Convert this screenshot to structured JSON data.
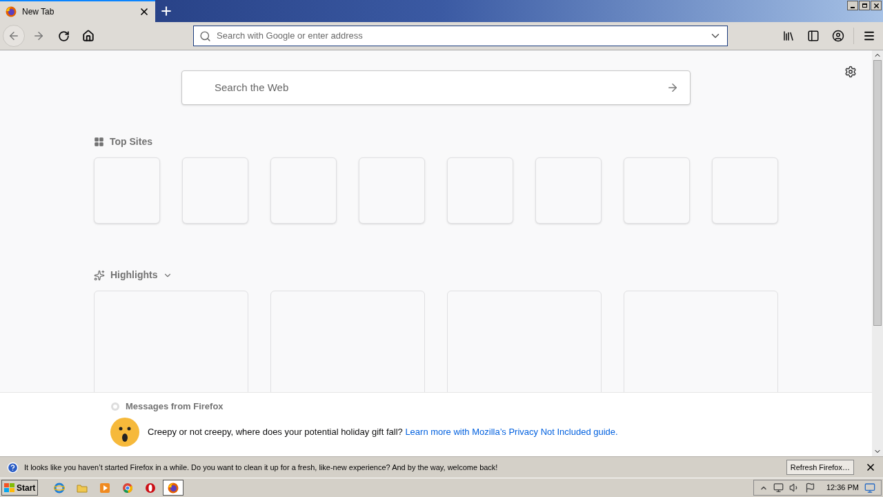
{
  "tabs": [
    {
      "title": "New Tab",
      "selected": true
    }
  ],
  "address_bar": {
    "placeholder": "Search with Google or enter address"
  },
  "search": {
    "placeholder": "Search the Web"
  },
  "top_sites": {
    "title": "Top Sites",
    "tiles": [
      {
        "kind": "empty"
      },
      {
        "kind": "empty"
      },
      {
        "kind": "empty"
      },
      {
        "kind": "empty"
      },
      {
        "kind": "empty"
      },
      {
        "kind": "empty"
      },
      {
        "kind": "empty"
      },
      {
        "kind": "empty"
      }
    ]
  },
  "highlights": {
    "title": "Highlights",
    "expanded": true,
    "cards": [
      {
        "kind": "empty"
      },
      {
        "kind": "empty"
      },
      {
        "kind": "empty"
      },
      {
        "kind": "empty"
      }
    ]
  },
  "messages": {
    "title": "Messages from Firefox",
    "text": "Creepy or not creepy, where does your potential holiday gift fall?",
    "link": "Learn more with Mozilla’s Privacy Not Included guide."
  },
  "notification": {
    "text": "It looks like you haven’t started Firefox in a while. Do you want to clean it up for a fresh, like-new experience? And by the way, welcome back!",
    "button": "Refresh Firefox…"
  },
  "taskbar": {
    "start": "Start",
    "apps": [
      {
        "kind": "ie",
        "selected": false
      },
      {
        "kind": "folder",
        "selected": false
      },
      {
        "kind": "media",
        "selected": false
      },
      {
        "kind": "chrome",
        "selected": false
      },
      {
        "kind": "opera",
        "selected": false
      },
      {
        "kind": "firefox",
        "selected": true
      }
    ],
    "clock": "12:36 PM"
  }
}
